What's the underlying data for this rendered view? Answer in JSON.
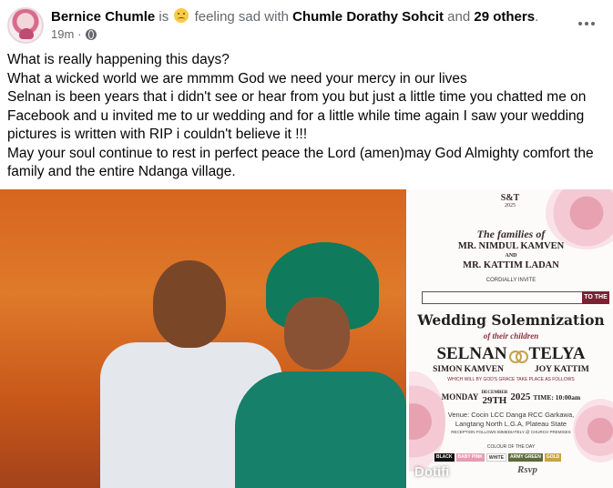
{
  "post": {
    "author": "Bernice Chumle",
    "is_word": "is",
    "feeling_text": "feeling sad with",
    "tagged_person": "Chumle Dorathy Sohcit",
    "and_word": "and",
    "others_count": "29 others",
    "period": ".",
    "timestamp": "19m",
    "dot": "·",
    "icons": {
      "feeling": "sad-face-emoji-icon",
      "audience": "globe-icon",
      "menu": "more-options-icon"
    },
    "text_lines": [
      "What is really happening this days?",
      "What a wicked world we are mmmm God we need your mercy in our lives",
      "Selnan is been years that i didn't see or hear from you but just a little time you chatted me on Facebook and u invited me to ur wedding and for a little while time again I saw your wedding pictures is written with RIP i couldn't believe it !!!",
      "May your soul continue to rest in perfect peace the Lord (amen)may God Almighty comfort the family and the entire Ndanga village."
    ]
  },
  "invitation": {
    "logo": "S&T",
    "logo_year": "2025",
    "families_of": "The families of",
    "family_1": "MR. NIMDUL KAMVEN",
    "and_1": "AND",
    "family_2": "MR. KATTIM LADAN",
    "cordially": "CORDIALLY INVITE",
    "to_the": "TO THE",
    "event_title": "Wedding Solemnization",
    "of_children": "of their children",
    "groom": "SELNAN",
    "bride": "TELYA",
    "groom_full": "SIMON KAMVEN",
    "bride_full": "JOY KATTIM",
    "grace_line": "WHICH WILL BY GOD'S GRACE TAKE PLACE AS FOLLOWS",
    "day": "MONDAY",
    "month": "DECEMBER",
    "date": "29TH",
    "year": "2025",
    "time": "TIME: 10:00am",
    "venue_1": "Venue: Cocin LCC Danga RCC Garkawa,",
    "venue_2": "Langtang North L.G.A, Plateau State",
    "reception": "RECEPTION FOLLOWS IMMEDIATELY @ CHURCH PREMISES",
    "colour_label": "COLOUR OF THE DAY",
    "colours": [
      "BLACK",
      "BABY PINK",
      "WHITE",
      "ARMY GREEN",
      "GOLD"
    ],
    "colour_hex": [
      "#111111",
      "#e79bb3",
      "#ffffff",
      "#5c6b3a",
      "#c9a442"
    ],
    "rsvp": "Rsvp"
  },
  "watermark": "Dotifi"
}
